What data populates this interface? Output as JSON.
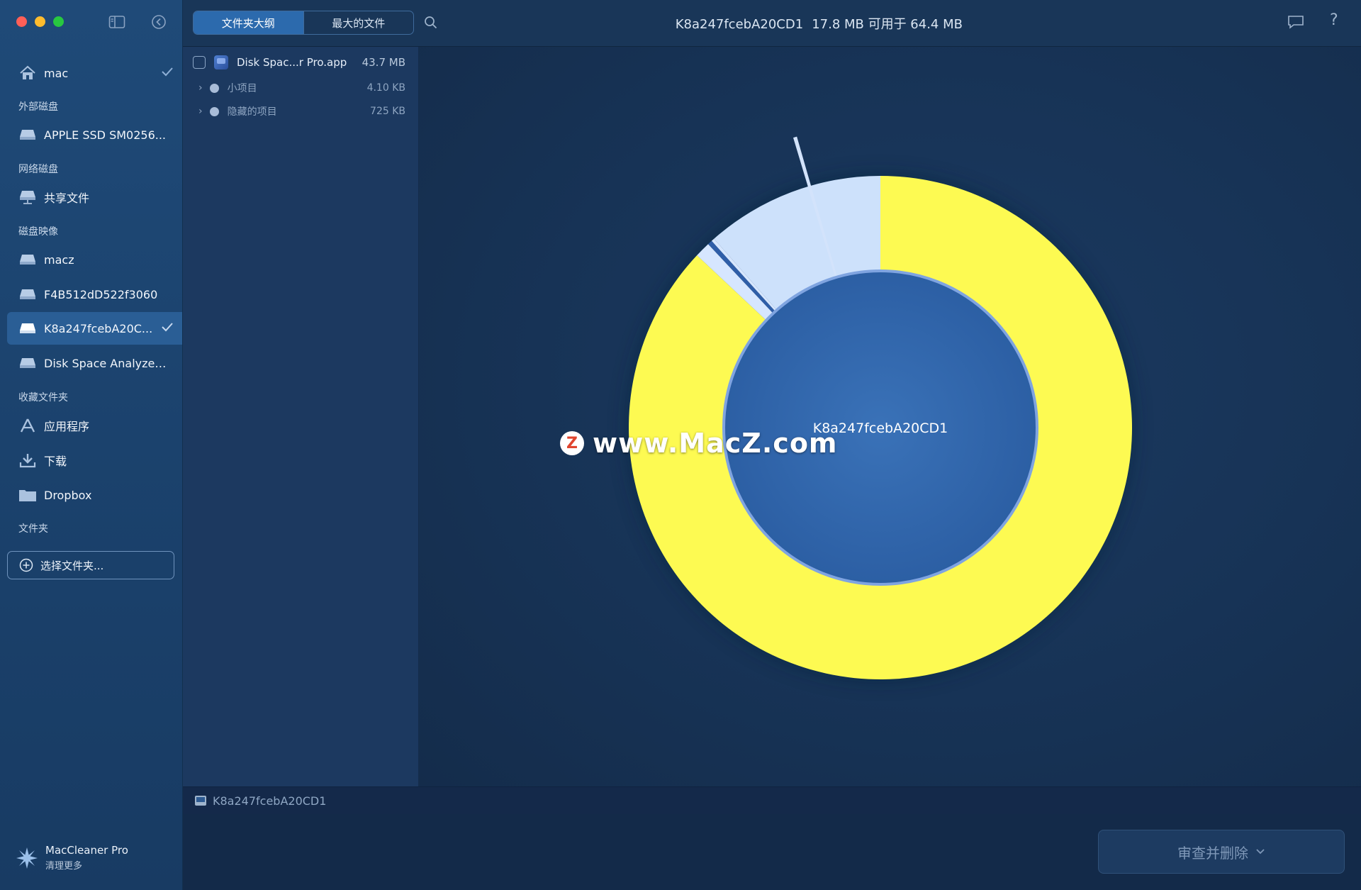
{
  "sidebar": {
    "items": {
      "mac": "mac",
      "apple_ssd": "APPLE SSD SM0256...",
      "shared": "共享文件",
      "macz": "macz",
      "f4b": "F4B512dD522f3060",
      "k8a": "K8a247fcebA20C...",
      "dsa": "Disk Space Analyzer...",
      "apps": "应用程序",
      "downloads": "下载",
      "dropbox": "Dropbox"
    },
    "sections": {
      "external": "外部磁盘",
      "network": "网络磁盘",
      "images": "磁盘映像",
      "favorites": "收藏文件夹",
      "folders": "文件夹"
    },
    "choose_folder": "选择文件夹...",
    "brand": {
      "name": "MacCleaner Pro",
      "sub": "清理更多"
    }
  },
  "toolbar": {
    "tab_outline": "文件夹大纲",
    "tab_largest": "最大的文件",
    "disk_name": "K8a247fcebA20CD1",
    "disk_info": "17.8 MB 可用于 64.4 MB",
    "help": "?"
  },
  "filelist": {
    "rows": [
      {
        "name": "Disk Spac...r Pro.app",
        "size": "43.7 MB"
      },
      {
        "name": "小项目",
        "size": "4.10 KB"
      },
      {
        "name": "隐藏的项目",
        "size": "725 KB"
      }
    ]
  },
  "chart_data": {
    "type": "pie",
    "center_label": "K8a247fcebA20CD1",
    "slices": [
      {
        "value": 0.87,
        "color": "#fdfa52"
      },
      {
        "value": 0.01,
        "color": "#d6e6ff"
      },
      {
        "value": 0.003,
        "color": "#2f5ea8"
      },
      {
        "value": 0.002,
        "color": "#d6e6ff"
      },
      {
        "value": 0.115,
        "color": "#cde1fb"
      }
    ],
    "outlier_color": "#d3e3fb",
    "inner_color": "#3267ac"
  },
  "watermark": {
    "logo": "Z",
    "text": "www.MacZ.com"
  },
  "pathbar": {
    "text": "K8a247fcebA20CD1"
  },
  "bottom": {
    "review_button": "审查并删除"
  }
}
